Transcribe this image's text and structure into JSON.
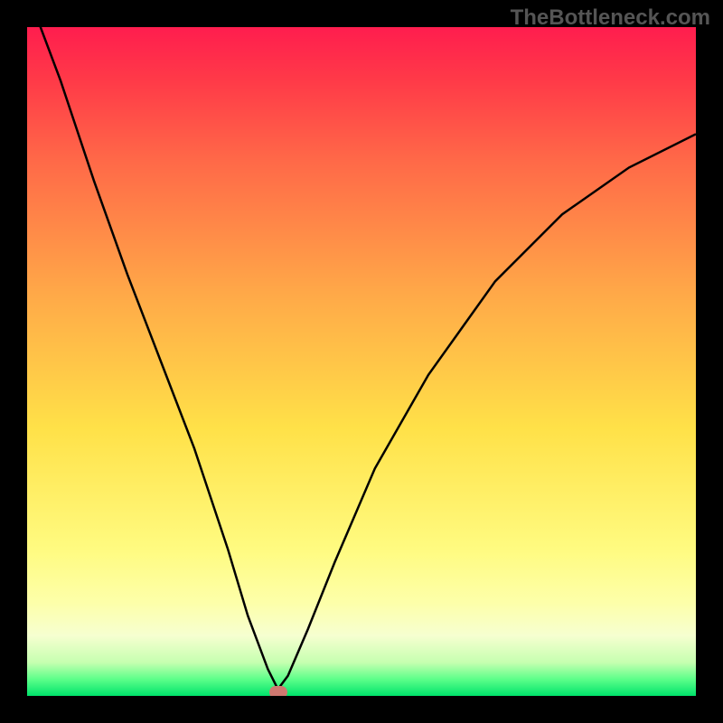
{
  "watermark": "TheBottleneck.com",
  "chart_data": {
    "type": "line",
    "title": "",
    "xlabel": "",
    "ylabel": "",
    "xlim": [
      0,
      100
    ],
    "ylim": [
      0,
      100
    ],
    "grid": false,
    "legend": false,
    "background_gradient_meaning": "red=high bottleneck, green=no bottleneck",
    "series": [
      {
        "name": "bottleneck-curve",
        "x": [
          0,
          2,
          5,
          10,
          15,
          20,
          25,
          30,
          33,
          36,
          37.5,
          39,
          42,
          46,
          52,
          60,
          70,
          80,
          90,
          100
        ],
        "y": [
          110,
          100,
          92,
          77,
          63,
          50,
          37,
          22,
          12,
          4,
          1,
          3,
          10,
          20,
          34,
          48,
          62,
          72,
          79,
          84
        ]
      }
    ],
    "marker": {
      "name": "optimal-point",
      "x": 37.5,
      "y": 0.5,
      "color": "#cf7870"
    }
  }
}
